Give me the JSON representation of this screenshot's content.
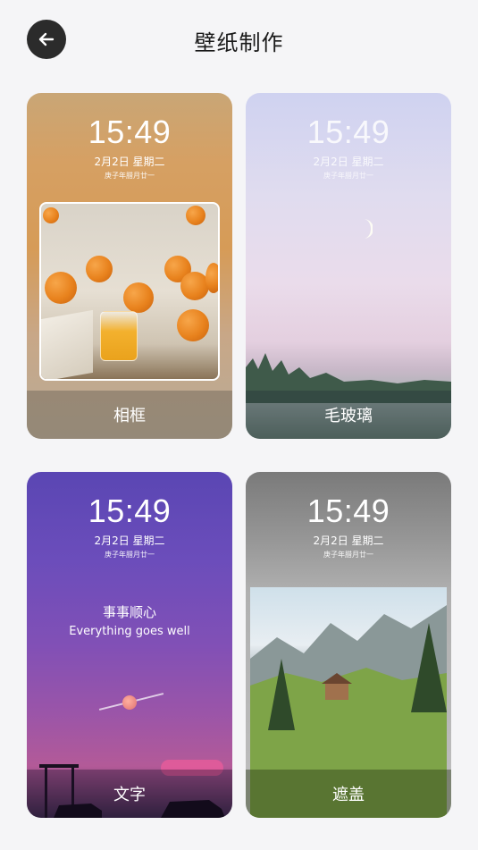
{
  "header": {
    "title": "壁纸制作",
    "back_icon": "arrow-left-icon"
  },
  "lockscreen": {
    "time": "15:49",
    "date": "2月2日 星期二",
    "lunar": "庚子年腊月廿一"
  },
  "cards": [
    {
      "label": "相框"
    },
    {
      "label": "毛玻璃"
    },
    {
      "label": "文字",
      "wish_cn": "事事顺心",
      "wish_en": "Everything goes well"
    },
    {
      "label": "遮盖"
    }
  ],
  "colors": {
    "background": "#f5f5f7",
    "back_button": "#2b2b2b",
    "title_text": "#1a1a1a"
  }
}
